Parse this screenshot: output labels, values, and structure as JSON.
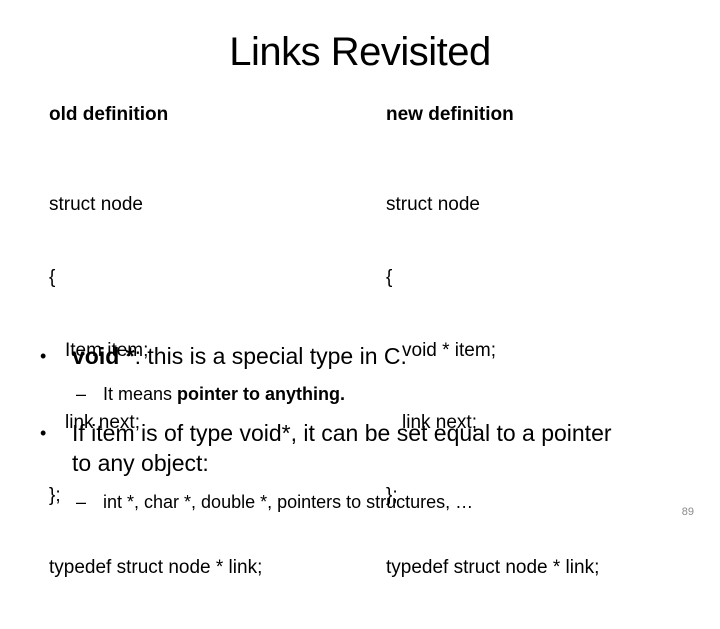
{
  "slide": {
    "title": "Links Revisited",
    "page_number": "89"
  },
  "columns": {
    "left": {
      "heading": "old definition",
      "code_lines": [
        "struct node",
        "{",
        "Item item;",
        "link next;",
        "};",
        "typedef struct node * link;"
      ]
    },
    "right": {
      "heading": "new definition",
      "code_lines": [
        "struct node",
        "{",
        "void * item;",
        "link next;",
        "};",
        "typedef struct node * link;"
      ]
    }
  },
  "bullets": [
    {
      "marker": "•",
      "bold_prefix": "void *",
      "text": ": this is a special type in C.",
      "sub": {
        "marker": "–",
        "text": "It means ",
        "bold_suffix": "pointer to anything."
      }
    },
    {
      "marker": "•",
      "text": "If item is of type void*, it can be set equal to a pointer to any object:",
      "sub": {
        "marker": "–",
        "text": "int *, char *, double *, pointers to structures, …"
      }
    }
  ]
}
